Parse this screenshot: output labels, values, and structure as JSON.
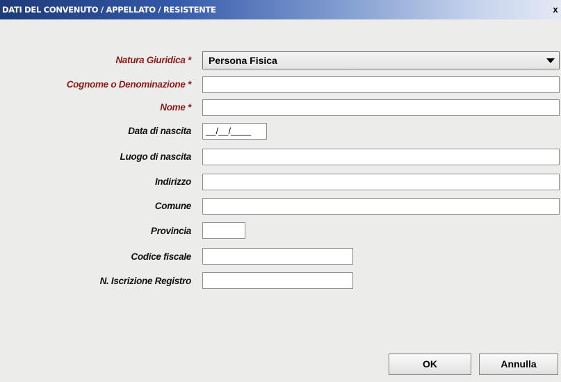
{
  "window": {
    "title": "DATI DEL CONVENUTO / APPELLATO / RESISTENTE",
    "close_label": "x"
  },
  "form": {
    "natura_giuridica": {
      "label": "Natura Giuridica *",
      "value": "Persona Fisica"
    },
    "cognome": {
      "label": "Cognome o Denominazione *",
      "value": ""
    },
    "nome": {
      "label": "Nome *",
      "value": ""
    },
    "data_nascita": {
      "label": "Data di nascita",
      "mask": "__/__/____"
    },
    "luogo_nascita": {
      "label": "Luogo di nascita",
      "value": ""
    },
    "indirizzo": {
      "label": "Indirizzo",
      "value": ""
    },
    "comune": {
      "label": "Comune",
      "value": ""
    },
    "provincia": {
      "label": "Provincia",
      "value": ""
    },
    "codice_fiscale": {
      "label": "Codice fiscale",
      "value": ""
    },
    "iscrizione_registro": {
      "label": "N. Iscrizione Registro",
      "value": ""
    }
  },
  "buttons": {
    "ok": "OK",
    "annulla": "Annulla"
  },
  "colors": {
    "required_label": "#8b1a1a",
    "title_bar_start": "#1e3a78"
  }
}
